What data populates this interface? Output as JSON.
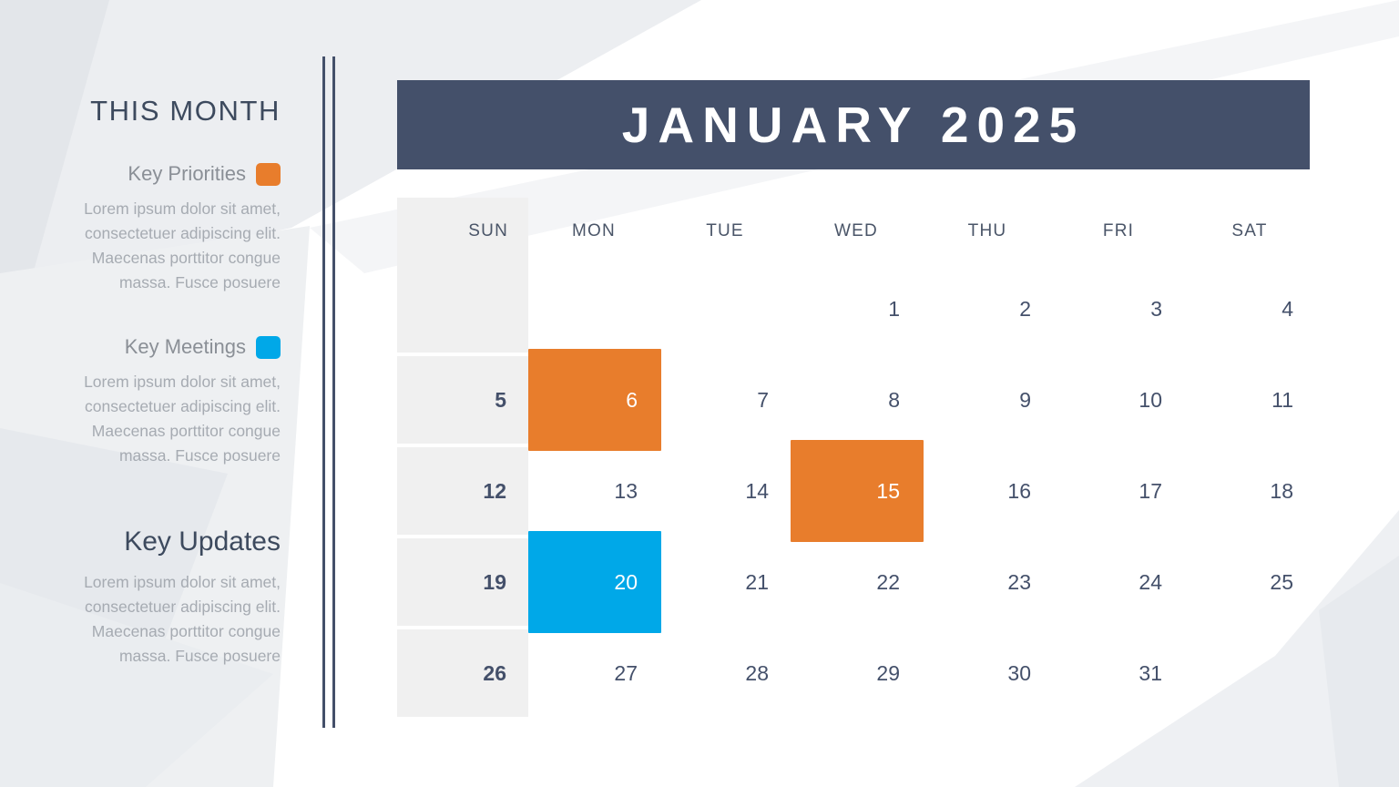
{
  "theme": {
    "header_bg": "#44506a",
    "orange": "#e87d2c",
    "blue": "#00a8e8",
    "sunday_bg": "#f0f0f0",
    "text_dark": "#3d4a5e",
    "text_muted": "#a6abb2",
    "page_bg": "#ffffff"
  },
  "sidebar": {
    "section_title": "THIS MONTH",
    "legends": [
      {
        "title": "Key Priorities",
        "swatch_name": "orange-swatch",
        "swatch_color": "#e87d2c",
        "body": "Lorem ipsum dolor sit amet, consectetuer adipiscing elit. Maecenas porttitor congue massa. Fusce posuere"
      },
      {
        "title": "Key Meetings",
        "swatch_name": "blue-swatch",
        "swatch_color": "#00a8e8",
        "body": "Lorem ipsum dolor sit amet, consectetuer adipiscing elit. Maecenas porttitor congue massa. Fusce posuere"
      }
    ],
    "key_updates": {
      "title": "Key Updates",
      "body": "Lorem ipsum dolor sit amet, consectetuer adipiscing elit. Maecenas porttitor congue massa. Fusce posuere"
    }
  },
  "calendar": {
    "title": "JANUARY 2025",
    "month": "JANUARY",
    "year": "2025",
    "weekdays": [
      "SUN",
      "MON",
      "TUE",
      "WED",
      "THU",
      "FRI",
      "SAT"
    ],
    "weeks": [
      [
        {
          "day": "",
          "highlight": null
        },
        {
          "day": "",
          "highlight": null
        },
        {
          "day": "",
          "highlight": null
        },
        {
          "day": "1",
          "highlight": null
        },
        {
          "day": "2",
          "highlight": null
        },
        {
          "day": "3",
          "highlight": null
        },
        {
          "day": "4",
          "highlight": null
        }
      ],
      [
        {
          "day": "5",
          "highlight": null
        },
        {
          "day": "6",
          "highlight": "orange"
        },
        {
          "day": "7",
          "highlight": null
        },
        {
          "day": "8",
          "highlight": null
        },
        {
          "day": "9",
          "highlight": null
        },
        {
          "day": "10",
          "highlight": null
        },
        {
          "day": "11",
          "highlight": null
        }
      ],
      [
        {
          "day": "12",
          "highlight": null
        },
        {
          "day": "13",
          "highlight": null
        },
        {
          "day": "14",
          "highlight": null
        },
        {
          "day": "15",
          "highlight": "orange"
        },
        {
          "day": "16",
          "highlight": null
        },
        {
          "day": "17",
          "highlight": null
        },
        {
          "day": "18",
          "highlight": null
        }
      ],
      [
        {
          "day": "19",
          "highlight": null
        },
        {
          "day": "20",
          "highlight": "blue"
        },
        {
          "day": "21",
          "highlight": null
        },
        {
          "day": "22",
          "highlight": null
        },
        {
          "day": "23",
          "highlight": null
        },
        {
          "day": "24",
          "highlight": null
        },
        {
          "day": "25",
          "highlight": null
        }
      ],
      [
        {
          "day": "26",
          "highlight": null
        },
        {
          "day": "27",
          "highlight": null
        },
        {
          "day": "28",
          "highlight": null
        },
        {
          "day": "29",
          "highlight": null
        },
        {
          "day": "30",
          "highlight": null
        },
        {
          "day": "31",
          "highlight": null
        },
        {
          "day": "",
          "highlight": null
        }
      ]
    ]
  }
}
